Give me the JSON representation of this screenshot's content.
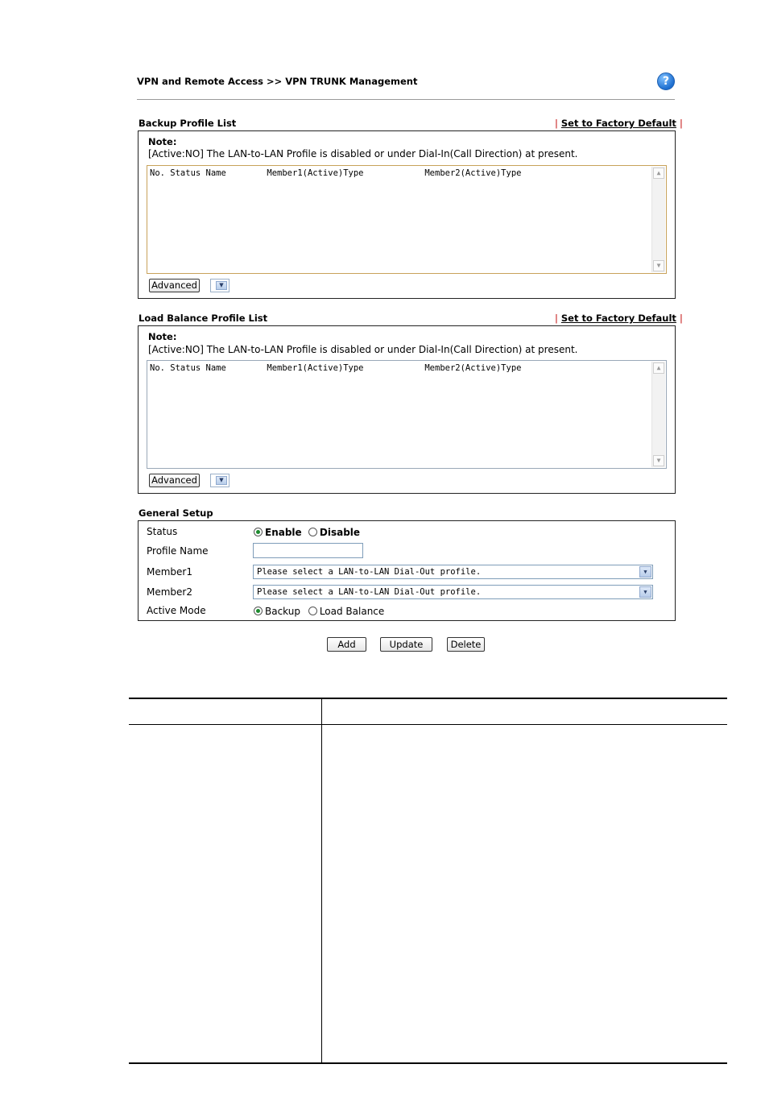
{
  "breadcrumb": "VPN and Remote Access >> VPN TRUNK Management",
  "help_icon": "?",
  "backup": {
    "title": "Backup Profile List",
    "factory_sep": "|",
    "factory_link": "Set to Factory Default",
    "note_title": "Note:",
    "note_text": "[Active:NO] The LAN-to-LAN Profile is disabled or under Dial-In(Call Direction) at present.",
    "list_header": "No. Status Name        Member1(Active)Type            Member2(Active)Type",
    "advanced_button": "Advanced"
  },
  "load_balance": {
    "title": "Load Balance Profile List",
    "factory_sep": "|",
    "factory_link": "Set to Factory Default",
    "note_title": "Note:",
    "note_text": "[Active:NO] The LAN-to-LAN Profile is disabled or under Dial-In(Call Direction) at present.",
    "list_header": "No. Status Name        Member1(Active)Type            Member2(Active)Type",
    "advanced_button": "Advanced"
  },
  "general_setup": {
    "title": "General Setup",
    "status_label": "Status",
    "status_enable": "Enable",
    "status_disable": "Disable",
    "status_selected": "Enable",
    "profile_name_label": "Profile Name",
    "profile_name_value": "",
    "member1_label": "Member1",
    "member1_value": "Please select a LAN-to-LAN Dial-Out profile.",
    "member2_label": "Member2",
    "member2_value": "Please select a LAN-to-LAN Dial-Out profile.",
    "active_mode_label": "Active Mode",
    "active_mode_backup": "Backup",
    "active_mode_load_balance": "Load Balance",
    "active_mode_selected": "Backup"
  },
  "actions": {
    "add": "Add",
    "update": "Update",
    "delete": "Delete"
  }
}
